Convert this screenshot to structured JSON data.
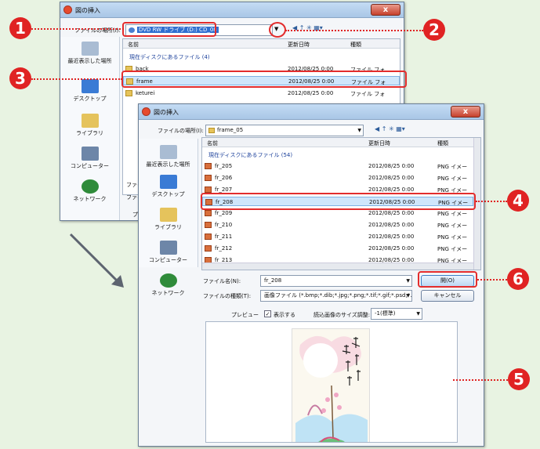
{
  "back_dialog": {
    "title": "図の挿入",
    "close": "x",
    "location_label": "ファイルの場所(I):",
    "location_value": "DVD RW ドライブ (D:) CD_08",
    "columns": {
      "name": "名前",
      "date": "更新日時",
      "type": "種類"
    },
    "group": "現在ディスクにあるファイル (4)",
    "places": [
      "最近表示した場所",
      "デスクトップ",
      "ライブラリ",
      "コンピューター",
      "ネットワーク"
    ],
    "rows": [
      {
        "name": "back",
        "date": "2012/08/25 0:00",
        "type": "ファイル フォ"
      },
      {
        "name": "frame",
        "date": "2012/08/25 0:00",
        "type": "ファイル フォ"
      },
      {
        "name": "keturei",
        "date": "2012/08/25 0:00",
        "type": "ファイル フォ"
      }
    ],
    "cut_labels": [
      "ファイ",
      "ファイ",
      "プレビ"
    ]
  },
  "front_dialog": {
    "title": "図の挿入",
    "close": "x",
    "location_label": "ファイルの場所(I):",
    "location_value": "frame_05",
    "columns": {
      "name": "名前",
      "date": "更新日時",
      "type": "種類"
    },
    "group": "現在ディスクにあるファイル (54)",
    "places": [
      "最近表示した場所",
      "デスクトップ",
      "ライブラリ",
      "コンピューター",
      "ネットワーク"
    ],
    "rows": [
      {
        "name": "fr_205",
        "date": "2012/08/25 0:00",
        "type": "PNG イメー"
      },
      {
        "name": "fr_206",
        "date": "2012/08/25 0:00",
        "type": "PNG イメー"
      },
      {
        "name": "fr_207",
        "date": "2012/08/25 0:00",
        "type": "PNG イメー"
      },
      {
        "name": "fr_208",
        "date": "2012/08/25 0:00",
        "type": "PNG イメー"
      },
      {
        "name": "fr_209",
        "date": "2012/08/25 0:00",
        "type": "PNG イメー"
      },
      {
        "name": "fr_210",
        "date": "2012/08/25 0:00",
        "type": "PNG イメー"
      },
      {
        "name": "fr_211",
        "date": "2012/08/25 0:00",
        "type": "PNG イメー"
      },
      {
        "name": "fr_212",
        "date": "2012/08/25 0:00",
        "type": "PNG イメー"
      },
      {
        "name": "fr_213",
        "date": "2012/08/25 0:00",
        "type": "PNG イメー"
      }
    ],
    "filename_label": "ファイル名(N):",
    "filename_value": "fr_208",
    "filetype_label": "ファイルの種類(T):",
    "filetype_value": "画像ファイル (*.bmp;*.dib;*.jpg;*.png;*.tif;*.gif;*.psd;*.fp",
    "open_button": "開(O)",
    "cancel_button": "キャンセル",
    "preview_label": "プレビュー",
    "show_label": "表示する",
    "size_label": "読込画像のサイズ調整:",
    "size_value": "-1(標準)"
  },
  "markers": [
    "1",
    "2",
    "3",
    "4",
    "5",
    "6"
  ],
  "colors": {
    "marker": "#e02323",
    "accent_selection": "#cfe6fb"
  }
}
